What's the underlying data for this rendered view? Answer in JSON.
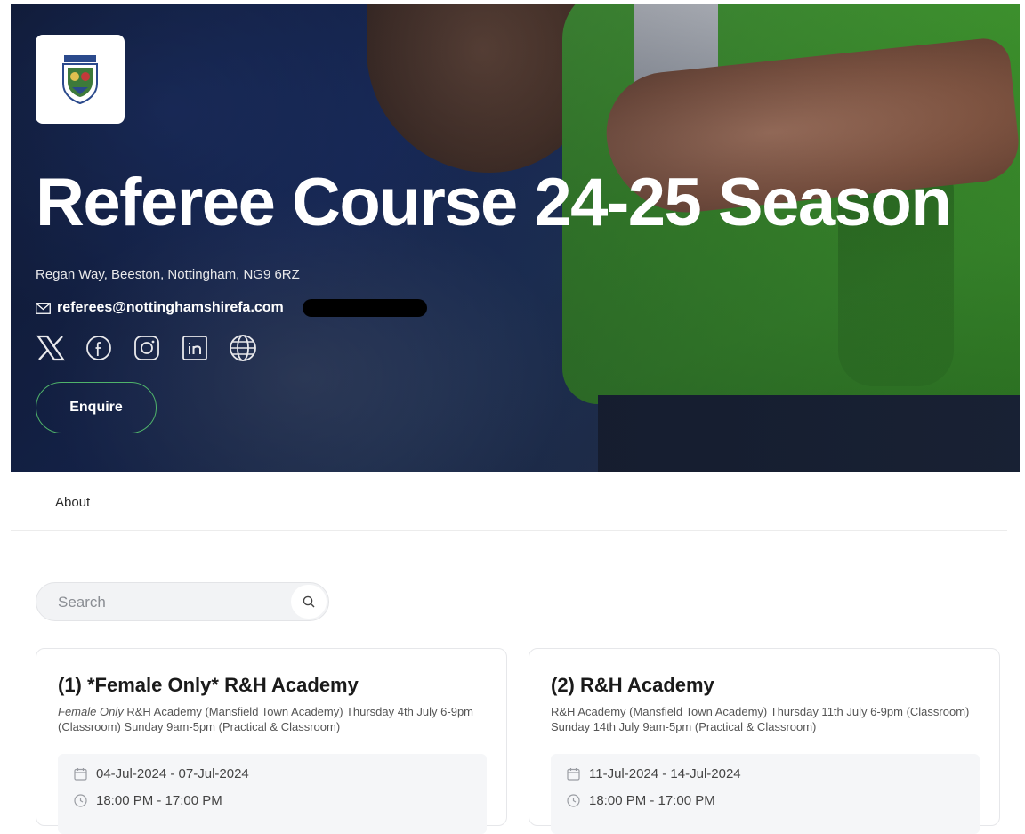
{
  "hero": {
    "title": "Referee Course 24-25 Season",
    "address": "Regan Way, Beeston, Nottingham, NG9 6RZ",
    "email": "referees@nottinghamshirefa.com",
    "social_icons": [
      "x-icon",
      "facebook-icon",
      "instagram-icon",
      "linkedin-icon",
      "globe-icon"
    ],
    "enquire_label": "Enquire",
    "accent_color": "#4fb36a"
  },
  "tabs": [
    {
      "label": "About"
    }
  ],
  "search": {
    "placeholder": "Search",
    "value": ""
  },
  "events": [
    {
      "title": "(1) *Female Only* R&H Academy",
      "desc_italic": "Female Only",
      "desc_rest": " R&H Academy (Mansfield Town Academy) Thursday 4th July 6-9pm (Classroom) Sunday 9am-5pm (Practical & Classroom)",
      "dates": "04-Jul-2024 - 07-Jul-2024",
      "times": "18:00 PM - 17:00 PM"
    },
    {
      "title": "(2) R&H Academy",
      "desc_italic": "",
      "desc_rest": "R&H Academy (Mansfield Town Academy) Thursday 11th July 6-9pm (Classroom) Sunday 14th July 9am-5pm (Practical & Classroom)",
      "dates": "11-Jul-2024 - 14-Jul-2024",
      "times": "18:00 PM - 17:00 PM"
    }
  ]
}
